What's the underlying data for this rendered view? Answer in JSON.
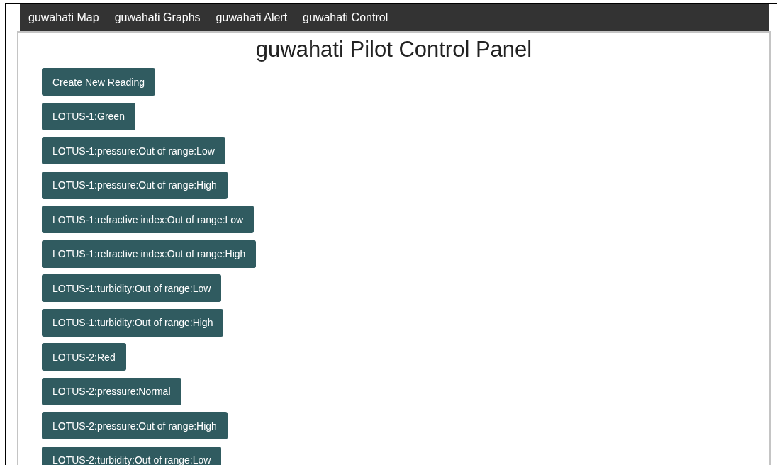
{
  "nav": {
    "items": [
      {
        "label": "guwahati Map"
      },
      {
        "label": "guwahati Graphs"
      },
      {
        "label": "guwahati Alert"
      },
      {
        "label": "guwahati Control"
      }
    ]
  },
  "panel": {
    "title": "guwahati Pilot Control Panel",
    "buttons": [
      "Create New Reading",
      "LOTUS-1:Green",
      "LOTUS-1:pressure:Out of range:Low",
      "LOTUS-1:pressure:Out of range:High",
      "LOTUS-1:refractive index:Out of range:Low",
      "LOTUS-1:refractive index:Out of range:High",
      "LOTUS-1:turbidity:Out of range:Low",
      "LOTUS-1:turbidity:Out of range:High",
      "LOTUS-2:Red",
      "LOTUS-2:pressure:Normal",
      "LOTUS-2:pressure:Out of range:High",
      "LOTUS-2:turbidity:Out of range:Low"
    ]
  }
}
